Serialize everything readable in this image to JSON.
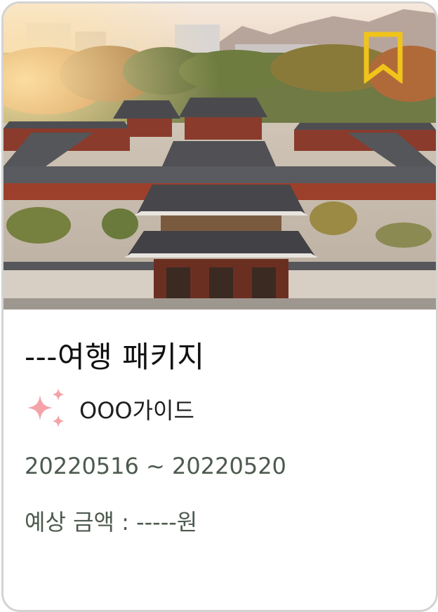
{
  "package": {
    "title": "---여행 패키지",
    "guide_name": "OOO가이드",
    "date_range": "20220516 ~ 20220520",
    "price_label": "예상 금액 : -----원"
  },
  "icons": {
    "bookmark": "bookmark-icon",
    "guide": "sparkle-icon"
  },
  "colors": {
    "bookmark": "#f0c419",
    "sparkle": "#f4a3a8",
    "title_text": "#111111",
    "meta_text": "#4d5a4e",
    "card_border": "#d3d3d3"
  }
}
